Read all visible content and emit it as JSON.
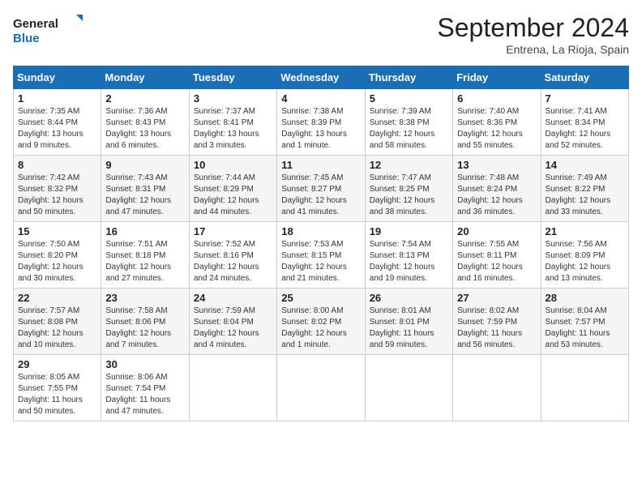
{
  "logo": {
    "line1": "General",
    "line2": "Blue"
  },
  "header": {
    "month": "September 2024",
    "location": "Entrena, La Rioja, Spain"
  },
  "days_of_week": [
    "Sunday",
    "Monday",
    "Tuesday",
    "Wednesday",
    "Thursday",
    "Friday",
    "Saturday"
  ],
  "weeks": [
    [
      {
        "day": "1",
        "lines": [
          "Sunrise: 7:35 AM",
          "Sunset: 8:44 PM",
          "Daylight: 13 hours",
          "and 9 minutes."
        ]
      },
      {
        "day": "2",
        "lines": [
          "Sunrise: 7:36 AM",
          "Sunset: 8:43 PM",
          "Daylight: 13 hours",
          "and 6 minutes."
        ]
      },
      {
        "day": "3",
        "lines": [
          "Sunrise: 7:37 AM",
          "Sunset: 8:41 PM",
          "Daylight: 13 hours",
          "and 3 minutes."
        ]
      },
      {
        "day": "4",
        "lines": [
          "Sunrise: 7:38 AM",
          "Sunset: 8:39 PM",
          "Daylight: 13 hours",
          "and 1 minute."
        ]
      },
      {
        "day": "5",
        "lines": [
          "Sunrise: 7:39 AM",
          "Sunset: 8:38 PM",
          "Daylight: 12 hours",
          "and 58 minutes."
        ]
      },
      {
        "day": "6",
        "lines": [
          "Sunrise: 7:40 AM",
          "Sunset: 8:36 PM",
          "Daylight: 12 hours",
          "and 55 minutes."
        ]
      },
      {
        "day": "7",
        "lines": [
          "Sunrise: 7:41 AM",
          "Sunset: 8:34 PM",
          "Daylight: 12 hours",
          "and 52 minutes."
        ]
      }
    ],
    [
      {
        "day": "8",
        "lines": [
          "Sunrise: 7:42 AM",
          "Sunset: 8:32 PM",
          "Daylight: 12 hours",
          "and 50 minutes."
        ]
      },
      {
        "day": "9",
        "lines": [
          "Sunrise: 7:43 AM",
          "Sunset: 8:31 PM",
          "Daylight: 12 hours",
          "and 47 minutes."
        ]
      },
      {
        "day": "10",
        "lines": [
          "Sunrise: 7:44 AM",
          "Sunset: 8:29 PM",
          "Daylight: 12 hours",
          "and 44 minutes."
        ]
      },
      {
        "day": "11",
        "lines": [
          "Sunrise: 7:45 AM",
          "Sunset: 8:27 PM",
          "Daylight: 12 hours",
          "and 41 minutes."
        ]
      },
      {
        "day": "12",
        "lines": [
          "Sunrise: 7:47 AM",
          "Sunset: 8:25 PM",
          "Daylight: 12 hours",
          "and 38 minutes."
        ]
      },
      {
        "day": "13",
        "lines": [
          "Sunrise: 7:48 AM",
          "Sunset: 8:24 PM",
          "Daylight: 12 hours",
          "and 36 minutes."
        ]
      },
      {
        "day": "14",
        "lines": [
          "Sunrise: 7:49 AM",
          "Sunset: 8:22 PM",
          "Daylight: 12 hours",
          "and 33 minutes."
        ]
      }
    ],
    [
      {
        "day": "15",
        "lines": [
          "Sunrise: 7:50 AM",
          "Sunset: 8:20 PM",
          "Daylight: 12 hours",
          "and 30 minutes."
        ]
      },
      {
        "day": "16",
        "lines": [
          "Sunrise: 7:51 AM",
          "Sunset: 8:18 PM",
          "Daylight: 12 hours",
          "and 27 minutes."
        ]
      },
      {
        "day": "17",
        "lines": [
          "Sunrise: 7:52 AM",
          "Sunset: 8:16 PM",
          "Daylight: 12 hours",
          "and 24 minutes."
        ]
      },
      {
        "day": "18",
        "lines": [
          "Sunrise: 7:53 AM",
          "Sunset: 8:15 PM",
          "Daylight: 12 hours",
          "and 21 minutes."
        ]
      },
      {
        "day": "19",
        "lines": [
          "Sunrise: 7:54 AM",
          "Sunset: 8:13 PM",
          "Daylight: 12 hours",
          "and 19 minutes."
        ]
      },
      {
        "day": "20",
        "lines": [
          "Sunrise: 7:55 AM",
          "Sunset: 8:11 PM",
          "Daylight: 12 hours",
          "and 16 minutes."
        ]
      },
      {
        "day": "21",
        "lines": [
          "Sunrise: 7:56 AM",
          "Sunset: 8:09 PM",
          "Daylight: 12 hours",
          "and 13 minutes."
        ]
      }
    ],
    [
      {
        "day": "22",
        "lines": [
          "Sunrise: 7:57 AM",
          "Sunset: 8:08 PM",
          "Daylight: 12 hours",
          "and 10 minutes."
        ]
      },
      {
        "day": "23",
        "lines": [
          "Sunrise: 7:58 AM",
          "Sunset: 8:06 PM",
          "Daylight: 12 hours",
          "and 7 minutes."
        ]
      },
      {
        "day": "24",
        "lines": [
          "Sunrise: 7:59 AM",
          "Sunset: 8:04 PM",
          "Daylight: 12 hours",
          "and 4 minutes."
        ]
      },
      {
        "day": "25",
        "lines": [
          "Sunrise: 8:00 AM",
          "Sunset: 8:02 PM",
          "Daylight: 12 hours",
          "and 1 minute."
        ]
      },
      {
        "day": "26",
        "lines": [
          "Sunrise: 8:01 AM",
          "Sunset: 8:01 PM",
          "Daylight: 11 hours",
          "and 59 minutes."
        ]
      },
      {
        "day": "27",
        "lines": [
          "Sunrise: 8:02 AM",
          "Sunset: 7:59 PM",
          "Daylight: 11 hours",
          "and 56 minutes."
        ]
      },
      {
        "day": "28",
        "lines": [
          "Sunrise: 8:04 AM",
          "Sunset: 7:57 PM",
          "Daylight: 11 hours",
          "and 53 minutes."
        ]
      }
    ],
    [
      {
        "day": "29",
        "lines": [
          "Sunrise: 8:05 AM",
          "Sunset: 7:55 PM",
          "Daylight: 11 hours",
          "and 50 minutes."
        ]
      },
      {
        "day": "30",
        "lines": [
          "Sunrise: 8:06 AM",
          "Sunset: 7:54 PM",
          "Daylight: 11 hours",
          "and 47 minutes."
        ]
      },
      {
        "day": "",
        "lines": []
      },
      {
        "day": "",
        "lines": []
      },
      {
        "day": "",
        "lines": []
      },
      {
        "day": "",
        "lines": []
      },
      {
        "day": "",
        "lines": []
      }
    ]
  ]
}
